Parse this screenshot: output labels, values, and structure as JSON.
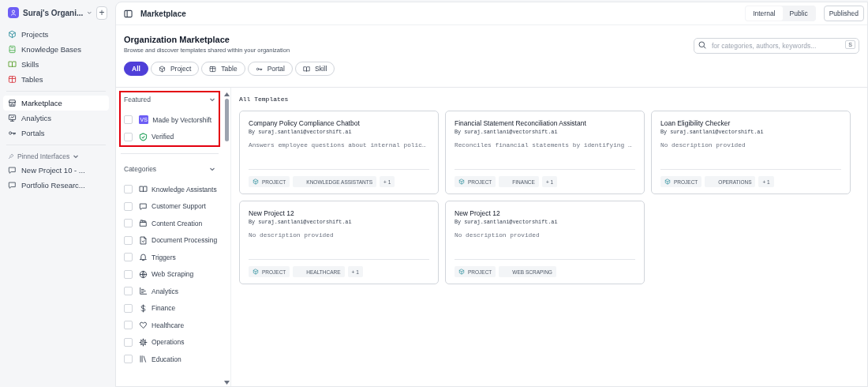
{
  "sidebar": {
    "org_name": "Suraj's Organi...",
    "add_button": "+",
    "nav_groups": [
      [
        {
          "label": "Projects",
          "selected": false
        },
        {
          "label": "Knowledge Bases",
          "selected": false
        },
        {
          "label": "Skills",
          "selected": false
        },
        {
          "label": "Tables",
          "selected": false
        }
      ],
      [
        {
          "label": "Marketplace",
          "selected": true
        },
        {
          "label": "Analytics",
          "selected": false
        },
        {
          "label": "Portals",
          "selected": false
        }
      ]
    ],
    "pinned_label": "Pinned Interfaces",
    "pinned": [
      {
        "label": "New Project 10 - ..."
      },
      {
        "label": "Portfolio Researc..."
      }
    ]
  },
  "header": {
    "title": "Marketplace",
    "toggle": [
      {
        "label": "Internal",
        "selected": true
      },
      {
        "label": "Public",
        "selected": false
      }
    ],
    "published_button": "Published"
  },
  "page": {
    "title": "Organization Marketplace",
    "subtitle": "Browse and discover templates shared within your organization",
    "search": {
      "placeholder": "for categories, authors, keywords...",
      "shortcut": "S"
    },
    "chips": [
      {
        "label": "All",
        "selected": true
      },
      {
        "label": "Project",
        "selected": false
      },
      {
        "label": "Table",
        "selected": false
      },
      {
        "label": "Portal",
        "selected": false
      },
      {
        "label": "Skill",
        "selected": false
      }
    ]
  },
  "filters": {
    "featured": {
      "title": "Featured",
      "items": [
        {
          "label": "Made by Vectorshift",
          "kind": "badge",
          "badge": "VS",
          "checked": false
        },
        {
          "label": "Verified",
          "kind": "verified",
          "checked": false
        }
      ]
    },
    "categories": {
      "title": "Categories",
      "items": [
        {
          "label": "Knowledge Assistants",
          "checked": false
        },
        {
          "label": "Customer Support",
          "checked": false
        },
        {
          "label": "Content Creation",
          "checked": false
        },
        {
          "label": "Document Processing",
          "checked": false
        },
        {
          "label": "Triggers",
          "checked": false
        },
        {
          "label": "Web Scraping",
          "checked": false
        },
        {
          "label": "Analytics",
          "checked": false
        },
        {
          "label": "Finance",
          "checked": false
        },
        {
          "label": "Healthcare",
          "checked": false
        },
        {
          "label": "Operations",
          "checked": false
        },
        {
          "label": "Education",
          "checked": false
        }
      ]
    }
  },
  "templates": {
    "title": "All Templates",
    "items": [
      {
        "title": "Company Policy Compliance Chatbot",
        "author": "By suraj.santlani@vectorshift.ai",
        "description": "Answers employee questions about internal polic…",
        "tags": [
          {
            "label": "PROJECT",
            "kind": "type"
          },
          {
            "label": "KNOWLEDGE ASSISTANTS",
            "kind": "category"
          },
          {
            "label": "+ 1",
            "kind": "more"
          }
        ]
      },
      {
        "title": "Financial Statement Reconciliation Assistant",
        "author": "By suraj.santlani@vectorshift.ai",
        "description": "Reconciles financial statements by identifying …",
        "tags": [
          {
            "label": "PROJECT",
            "kind": "type"
          },
          {
            "label": "FINANCE",
            "kind": "category"
          },
          {
            "label": "+ 1",
            "kind": "more"
          }
        ]
      },
      {
        "title": "Loan Eligibility Checker",
        "author": "By suraj.santlani@vectorshift.ai",
        "description": "No description provided",
        "tags": [
          {
            "label": "PROJECT",
            "kind": "type"
          },
          {
            "label": "OPERATIONS",
            "kind": "category"
          },
          {
            "label": "+ 1",
            "kind": "more"
          }
        ]
      },
      {
        "title": "New Project 12",
        "author": "By suraj.santlani@vectorshift.ai",
        "description": "No description provided",
        "tags": [
          {
            "label": "PROJECT",
            "kind": "type"
          },
          {
            "label": "HEALTHCARE",
            "kind": "category"
          },
          {
            "label": "+ 1",
            "kind": "more"
          }
        ]
      },
      {
        "title": "New Project 12",
        "author": "By suraj.santlani@vectorshift.ai",
        "description": "No description provided",
        "tags": [
          {
            "label": "PROJECT",
            "kind": "type"
          },
          {
            "label": "WEB SCRAPING",
            "kind": "category"
          }
        ]
      }
    ]
  }
}
